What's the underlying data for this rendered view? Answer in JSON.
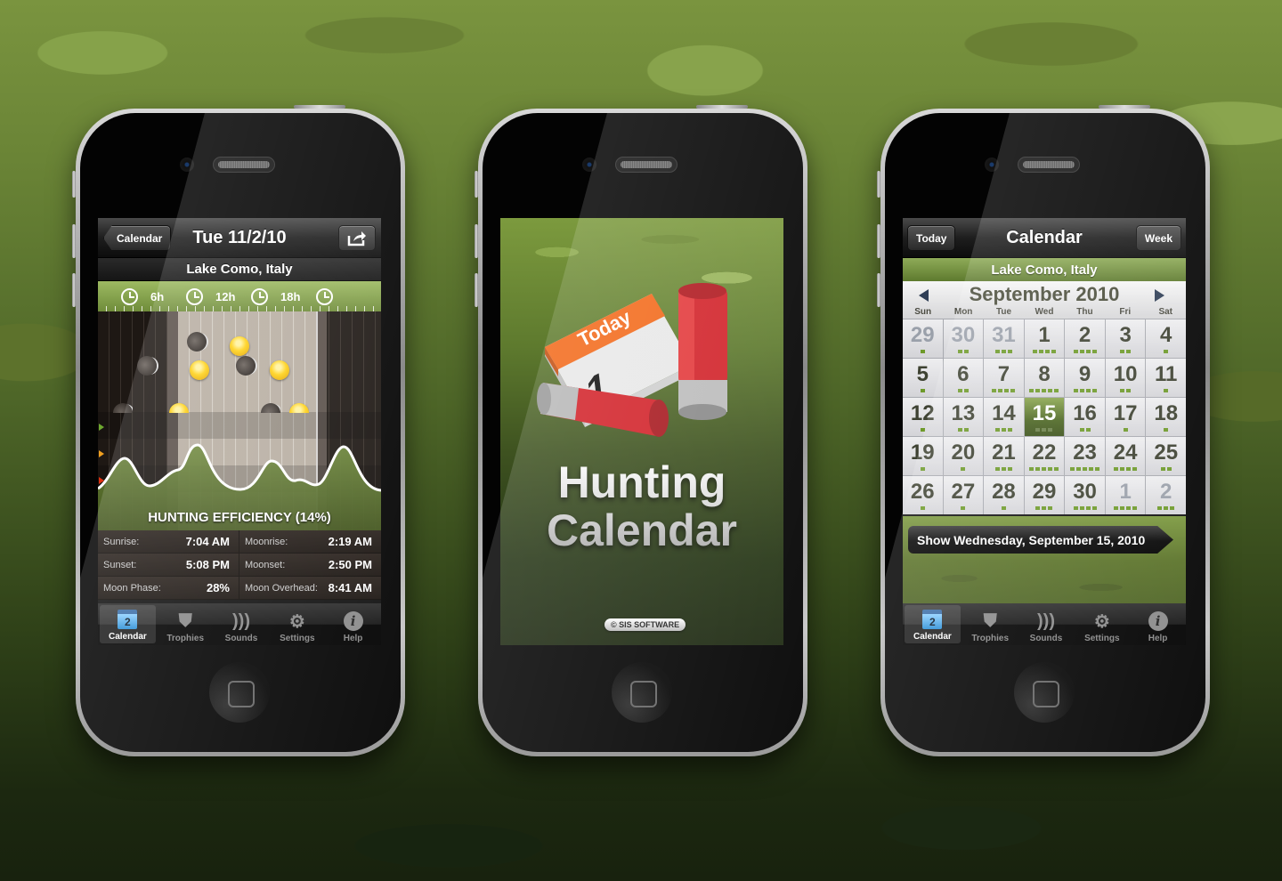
{
  "phones": [
    {
      "nav": {
        "back_label": "Calendar",
        "title": "Tue 11/2/10",
        "share_icon": "share-icon"
      },
      "location": "Lake Como, Italy",
      "timeline": [
        "6h",
        "12h",
        "18h"
      ],
      "efficiency_label": "HUNTING EFFICIENCY (14%)",
      "efficiency_percent": 14,
      "marker_colors": [
        "#6ea830",
        "#f0a020",
        "#e03010"
      ],
      "info": [
        {
          "label": "Sunrise:",
          "value": "7:04 AM"
        },
        {
          "label": "Moonrise:",
          "value": "2:19 AM"
        },
        {
          "label": "Sunset:",
          "value": "5:08 PM"
        },
        {
          "label": "Moonset:",
          "value": "2:50 PM"
        },
        {
          "label": "Moon Phase:",
          "value": "28%"
        },
        {
          "label": "Moon Overhead:",
          "value": "8:41 AM"
        }
      ]
    },
    {
      "splash": {
        "icon_badge": "Today",
        "icon_day": "1",
        "title_line1": "Hunting",
        "title_line2": "Calendar",
        "copyright": "© SIS SOFTWARE"
      }
    },
    {
      "nav": {
        "left_label": "Today",
        "title": "Calendar",
        "right_label": "Week"
      },
      "location": "Lake Como, Italy",
      "month_title": "September 2010",
      "weekdays": [
        "Sun",
        "Mon",
        "Tue",
        "Wed",
        "Thu",
        "Fri",
        "Sat"
      ],
      "days": [
        {
          "n": "29",
          "dots": 1,
          "other": true
        },
        {
          "n": "30",
          "dots": 2,
          "other": true
        },
        {
          "n": "31",
          "dots": 3,
          "other": true
        },
        {
          "n": "1",
          "dots": 4
        },
        {
          "n": "2",
          "dots": 4
        },
        {
          "n": "3",
          "dots": 2
        },
        {
          "n": "4",
          "dots": 1
        },
        {
          "n": "5",
          "dots": 1
        },
        {
          "n": "6",
          "dots": 2
        },
        {
          "n": "7",
          "dots": 4
        },
        {
          "n": "8",
          "dots": 5
        },
        {
          "n": "9",
          "dots": 4
        },
        {
          "n": "10",
          "dots": 2
        },
        {
          "n": "11",
          "dots": 1
        },
        {
          "n": "12",
          "dots": 1
        },
        {
          "n": "13",
          "dots": 2
        },
        {
          "n": "14",
          "dots": 3
        },
        {
          "n": "15",
          "dots": 3,
          "selected": true
        },
        {
          "n": "16",
          "dots": 2
        },
        {
          "n": "17",
          "dots": 1
        },
        {
          "n": "18",
          "dots": 1
        },
        {
          "n": "19",
          "dots": 1
        },
        {
          "n": "20",
          "dots": 1
        },
        {
          "n": "21",
          "dots": 3
        },
        {
          "n": "22",
          "dots": 5
        },
        {
          "n": "23",
          "dots": 5
        },
        {
          "n": "24",
          "dots": 4
        },
        {
          "n": "25",
          "dots": 2
        },
        {
          "n": "26",
          "dots": 1
        },
        {
          "n": "27",
          "dots": 1
        },
        {
          "n": "28",
          "dots": 1
        },
        {
          "n": "29",
          "dots": 3
        },
        {
          "n": "30",
          "dots": 4
        },
        {
          "n": "1",
          "dots": 4,
          "other": true
        },
        {
          "n": "2",
          "dots": 3,
          "other": true
        }
      ],
      "show_button": "Show Wednesday, September 15, 2010"
    }
  ],
  "tabbar": {
    "calendar_day": "2",
    "tabs": [
      {
        "label": "Calendar",
        "icon": "calendar-icon",
        "active": true
      },
      {
        "label": "Trophies",
        "icon": "antlers-icon"
      },
      {
        "label": "Sounds",
        "icon": "duck-call-icon"
      },
      {
        "label": "Settings",
        "icon": "gear-icon"
      },
      {
        "label": "Help",
        "icon": "info-icon"
      }
    ]
  }
}
